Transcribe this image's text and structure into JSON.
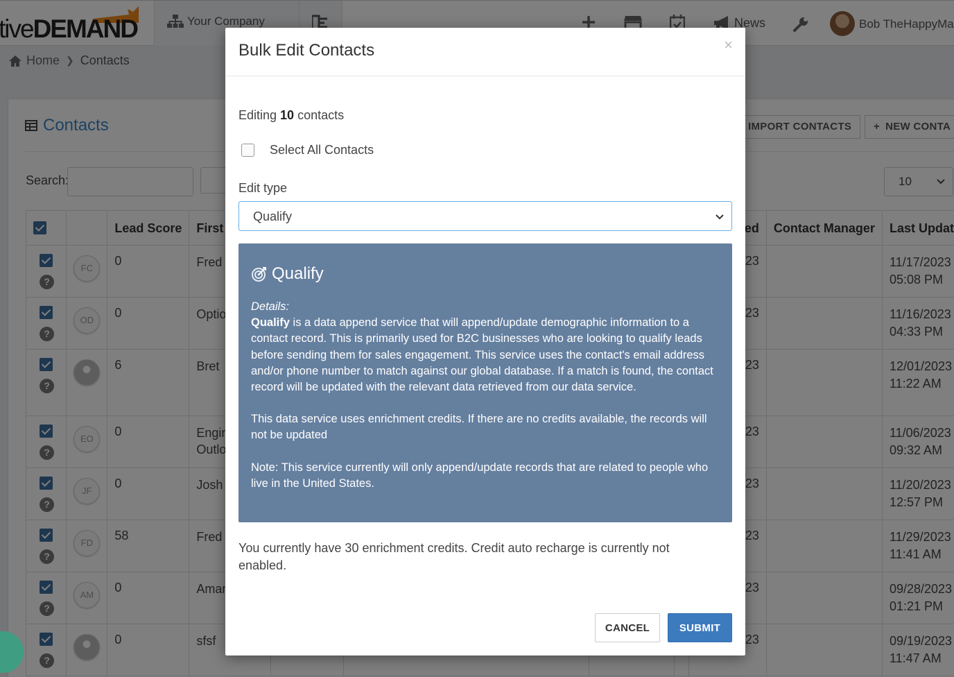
{
  "topbar": {
    "logo_light": "tive",
    "logo_bold": "DEMAND",
    "company": "Your Company",
    "news": "News",
    "user_name": "Bob TheHappyMar"
  },
  "breadcrumb": {
    "home": "Home",
    "current": "Contacts"
  },
  "panel": {
    "title": "Contacts",
    "import_label": "IMPORT CONTACTS",
    "new_label": "NEW CONTA",
    "search_label": "Search:",
    "page_size": "10"
  },
  "table": {
    "headers": [
      "",
      "",
      "Lead Score",
      "First n",
      "",
      "",
      "",
      "",
      "ed",
      "Contact Manager",
      "Last Update"
    ],
    "rows": [
      {
        "initials": "FC",
        "score": "0",
        "first": "Fred",
        "tail": "23",
        "date": "11/17/2023",
        "time": "05:08 PM"
      },
      {
        "initials": "OD",
        "score": "0",
        "first": "Option",
        "tail": "23",
        "date": "11/16/2023",
        "time": "04:33 PM"
      },
      {
        "initials": "",
        "score": "6",
        "first": "Bret",
        "tail": "23",
        "date": "12/01/2023",
        "time": "11:22 AM"
      },
      {
        "initials": "EO",
        "score": "0",
        "first": "Engin\nOutlo",
        "tail": "23",
        "date": "11/06/2023",
        "time": "09:32 AM"
      },
      {
        "initials": "JF",
        "score": "0",
        "first": "Josh",
        "tail": "23",
        "date": "11/20/2023",
        "time": "12:57 PM"
      },
      {
        "initials": "FD",
        "score": "58",
        "first": "Fred",
        "tail": "23",
        "date": "11/29/2023",
        "time": "11:41 AM"
      },
      {
        "initials": "AM",
        "score": "0",
        "first": "Aman",
        "tail": "23",
        "date": "09/28/2023",
        "time": "01:21 PM"
      },
      {
        "initials": "",
        "score": "0",
        "first": "sfsf",
        "tail": "23",
        "date": "09/19/2023",
        "time": "11:47 AM"
      }
    ]
  },
  "modal": {
    "title": "Bulk Edit Contacts",
    "close": "×",
    "editing_prefix": "Editing ",
    "editing_count": "10",
    "editing_suffix": " contacts",
    "select_all_label": "Select All Contacts",
    "edit_type_label": "Edit type",
    "edit_type_value": "Qualify",
    "info": {
      "title": "Qualify",
      "details_label": "Details:",
      "lead_word": "Qualify",
      "description": " is a data append service that will append/update demographic information to a contact record. This is primarily used for B2C businesses who are looking to qualify leads before sending them for sales engagement. This service uses the contact's email address and/or phone number to match against our global database. If a match is found, the contact record will be updated with the relevant data retrieved from our data service.",
      "credits_note": "This data service uses enrichment credits. If there are no credits available, the records will not be updated",
      "us_note": "Note: This service currently will only append/update records that are related to people who live in the United States."
    },
    "credits_text": "You currently have 30 enrichment credits. Credit auto recharge is currently not enabled.",
    "cancel_label": "CANCEL",
    "submit_label": "SUBMIT"
  },
  "colors": {
    "accent": "#3c84c4",
    "info_box": "#657f9f",
    "submit": "#3d7bbf",
    "checkbox": "#3d6f9e"
  }
}
